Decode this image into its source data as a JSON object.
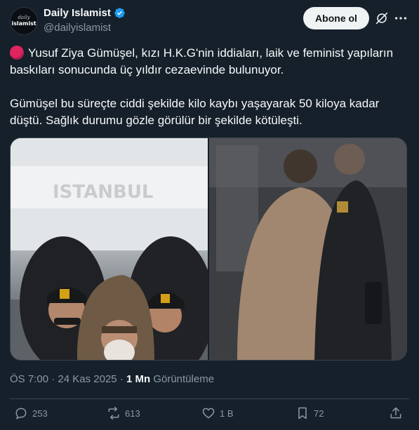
{
  "author": {
    "display_name": "Daily Islamist",
    "handle": "@dailyislamist",
    "avatar_text_line1": "daily",
    "avatar_text_line2": "islamist",
    "verified_color": "#1d9bf0"
  },
  "header": {
    "follow_label": "Abone ol",
    "grok_icon": "grok-icon",
    "more_icon": "more-horizontal-icon"
  },
  "tweet": {
    "paragraph1": "Yusuf Ziya Gümüşel, kızı H.K.G'nin iddiaları, laik ve feminist yapıların baskıları sonucunda üç yıldır cezaevinde bulunuyor.",
    "paragraph2": "Gümüşel bu süreçte ciddi şekilde kilo kaybı yaşayarak 50 kiloya kadar düştü. Sağlık durumu gözle görülür bir şekilde  kötüleşti.",
    "emoji": "red-circle"
  },
  "meta": {
    "time": "ÖS 7:00",
    "separator": "·",
    "date": "24 Kas 2025",
    "views_count": "1 Mn",
    "views_label": "Görüntüleme"
  },
  "actions": {
    "replies": "253",
    "reposts": "613",
    "likes": "1 B",
    "bookmarks": "72"
  },
  "colors": {
    "background": "#15202b",
    "text": "#f7f9f9",
    "muted": "#8b98a5",
    "border": "#38444d",
    "red_dot": "#e0245e"
  }
}
